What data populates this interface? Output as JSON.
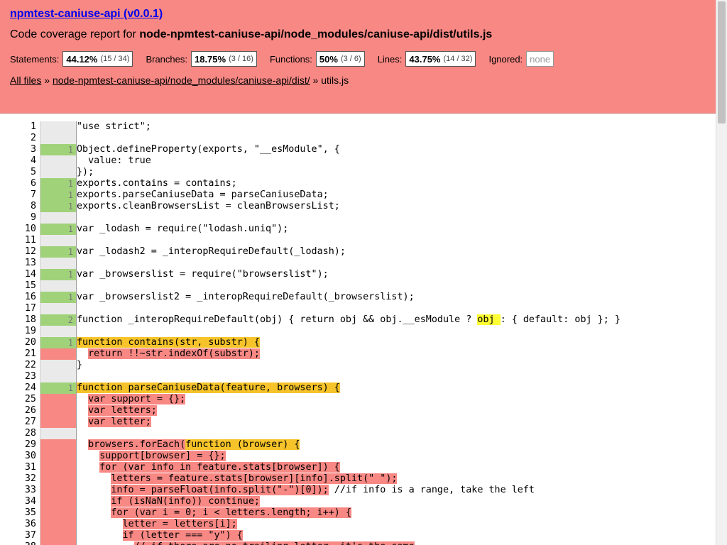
{
  "header": {
    "title": "npmtest-caniuse-api (v0.0.1)",
    "subtitle_prefix": "Code coverage report for ",
    "subtitle_path": "node-npmtest-caniuse-api/node_modules/caniuse-api/dist/utils.js",
    "stats": [
      {
        "label": "Statements:",
        "pct": "44.12%",
        "frac": "(15 / 34)"
      },
      {
        "label": "Branches:",
        "pct": "18.75%",
        "frac": "(3 / 16)"
      },
      {
        "label": "Functions:",
        "pct": "50%",
        "frac": "(3 / 6)"
      },
      {
        "label": "Lines:",
        "pct": "43.75%",
        "frac": "(14 / 32)"
      }
    ],
    "ignored_label": "Ignored:",
    "ignored_value": "none",
    "breadcrumb": {
      "all_files": "All files",
      "sep1": " » ",
      "dir": "node-npmtest-caniuse-api/node_modules/caniuse-api/dist/",
      "sep2": " » ",
      "file": "utils.js"
    }
  },
  "colors": {
    "header_bg": "#f88884",
    "covered": "#a0d27a",
    "uncovered": "#f88884",
    "fn_uncovered": "#f6c42a",
    "branch_highlight": "#ffff33"
  },
  "lines": [
    {
      "n": "1",
      "c": "",
      "k": "neutral",
      "segs": [
        {
          "t": "\"use strict\";"
        }
      ]
    },
    {
      "n": "2",
      "c": "",
      "k": "neutral",
      "segs": []
    },
    {
      "n": "3",
      "c": "1",
      "k": "yes",
      "segs": [
        {
          "t": "Object.defineProperty(exports, \"__esModule\", {"
        }
      ]
    },
    {
      "n": "4",
      "c": "",
      "k": "neutral",
      "segs": [
        {
          "t": "  value: true"
        }
      ]
    },
    {
      "n": "5",
      "c": "",
      "k": "neutral",
      "segs": [
        {
          "t": "});"
        }
      ]
    },
    {
      "n": "6",
      "c": "1",
      "k": "yes",
      "segs": [
        {
          "t": "exports.contains = contains;"
        }
      ]
    },
    {
      "n": "7",
      "c": "1",
      "k": "yes",
      "segs": [
        {
          "t": "exports.parseCaniuseData = parseCaniuseData;"
        }
      ]
    },
    {
      "n": "8",
      "c": "1",
      "k": "yes",
      "segs": [
        {
          "t": "exports.cleanBrowsersList = cleanBrowsersList;"
        }
      ]
    },
    {
      "n": "9",
      "c": "",
      "k": "neutral",
      "segs": []
    },
    {
      "n": "10",
      "c": "1",
      "k": "yes",
      "segs": [
        {
          "t": "var _lodash = require(\"lodash.uniq\");"
        }
      ]
    },
    {
      "n": "11",
      "c": "",
      "k": "neutral",
      "segs": []
    },
    {
      "n": "12",
      "c": "1",
      "k": "yes",
      "segs": [
        {
          "t": "var _lodash2 = _interopRequireDefault(_lodash);"
        }
      ]
    },
    {
      "n": "13",
      "c": "",
      "k": "neutral",
      "segs": []
    },
    {
      "n": "14",
      "c": "1",
      "k": "yes",
      "segs": [
        {
          "t": "var _browserslist = require(\"browserslist\");"
        }
      ]
    },
    {
      "n": "15",
      "c": "",
      "k": "neutral",
      "segs": []
    },
    {
      "n": "16",
      "c": "1",
      "k": "yes",
      "segs": [
        {
          "t": "var _browserslist2 = _interopRequireDefault(_browserslist);"
        }
      ]
    },
    {
      "n": "17",
      "c": "",
      "k": "neutral",
      "segs": []
    },
    {
      "n": "18",
      "c": "2",
      "k": "yes",
      "segs": [
        {
          "t": "function _interopRequireDefault(obj) { return obj && obj.__esModule ? "
        },
        {
          "t": "obj ",
          "h": "hl"
        },
        {
          "t": ": { default: obj }; }"
        }
      ]
    },
    {
      "n": "19",
      "c": "",
      "k": "neutral",
      "segs": []
    },
    {
      "n": "20",
      "c": "1",
      "k": "yes",
      "segs": [
        {
          "t": "function contains(str, substr) {",
          "h": "fn"
        }
      ]
    },
    {
      "n": "21",
      "c": "",
      "k": "no",
      "segs": [
        {
          "t": "  "
        },
        {
          "t": "return !!~str.indexOf(substr);",
          "h": "st"
        }
      ]
    },
    {
      "n": "22",
      "c": "",
      "k": "neutral",
      "segs": [
        {
          "t": "}"
        }
      ]
    },
    {
      "n": "23",
      "c": "",
      "k": "neutral",
      "segs": []
    },
    {
      "n": "24",
      "c": "1",
      "k": "yes",
      "segs": [
        {
          "t": "function parseCaniuseData(feature, browsers) {",
          "h": "fn"
        }
      ]
    },
    {
      "n": "25",
      "c": "",
      "k": "no",
      "segs": [
        {
          "t": "  "
        },
        {
          "t": "var support = {};",
          "h": "st"
        }
      ]
    },
    {
      "n": "26",
      "c": "",
      "k": "no",
      "segs": [
        {
          "t": "  "
        },
        {
          "t": "var letters;",
          "h": "st"
        }
      ]
    },
    {
      "n": "27",
      "c": "",
      "k": "no",
      "segs": [
        {
          "t": "  "
        },
        {
          "t": "var letter;",
          "h": "st"
        }
      ]
    },
    {
      "n": "28",
      "c": "",
      "k": "neutral",
      "segs": []
    },
    {
      "n": "29",
      "c": "",
      "k": "no",
      "segs": [
        {
          "t": "  "
        },
        {
          "t": "browsers.forEach(",
          "h": "st"
        },
        {
          "t": "function (browser) {",
          "h": "fn"
        }
      ]
    },
    {
      "n": "30",
      "c": "",
      "k": "no",
      "segs": [
        {
          "t": "    "
        },
        {
          "t": "support[browser] = {};",
          "h": "st"
        }
      ]
    },
    {
      "n": "31",
      "c": "",
      "k": "no",
      "segs": [
        {
          "t": "    "
        },
        {
          "t": "for (var info in feature.stats[browser]) {",
          "h": "st"
        }
      ]
    },
    {
      "n": "32",
      "c": "",
      "k": "no",
      "segs": [
        {
          "t": "      "
        },
        {
          "t": "letters = feature.stats[browser][info].split(\" \");",
          "h": "st"
        }
      ]
    },
    {
      "n": "33",
      "c": "",
      "k": "no",
      "segs": [
        {
          "t": "      "
        },
        {
          "t": "info = parseFloat(info.split(\"-\")[0]);",
          "h": "st"
        },
        {
          "t": " //if info is a range, take the left"
        }
      ]
    },
    {
      "n": "34",
      "c": "",
      "k": "no",
      "segs": [
        {
          "t": "      "
        },
        {
          "t": "if (isNaN(info)) continue;",
          "h": "st"
        }
      ]
    },
    {
      "n": "35",
      "c": "",
      "k": "no",
      "segs": [
        {
          "t": "      "
        },
        {
          "t": "for (var i = 0; i < letters.length; i++) {",
          "h": "st"
        }
      ]
    },
    {
      "n": "36",
      "c": "",
      "k": "no",
      "segs": [
        {
          "t": "        "
        },
        {
          "t": "letter = letters[i];",
          "h": "st"
        }
      ]
    },
    {
      "n": "37",
      "c": "",
      "k": "no",
      "segs": [
        {
          "t": "        "
        },
        {
          "t": "if (letter === \"y\") {",
          "h": "st"
        }
      ]
    },
    {
      "n": "38",
      "c": "",
      "k": "no",
      "segs": [
        {
          "t": "          "
        },
        {
          "t": "// if there are no trailing letter, it's the same",
          "h": "st"
        }
      ]
    }
  ]
}
